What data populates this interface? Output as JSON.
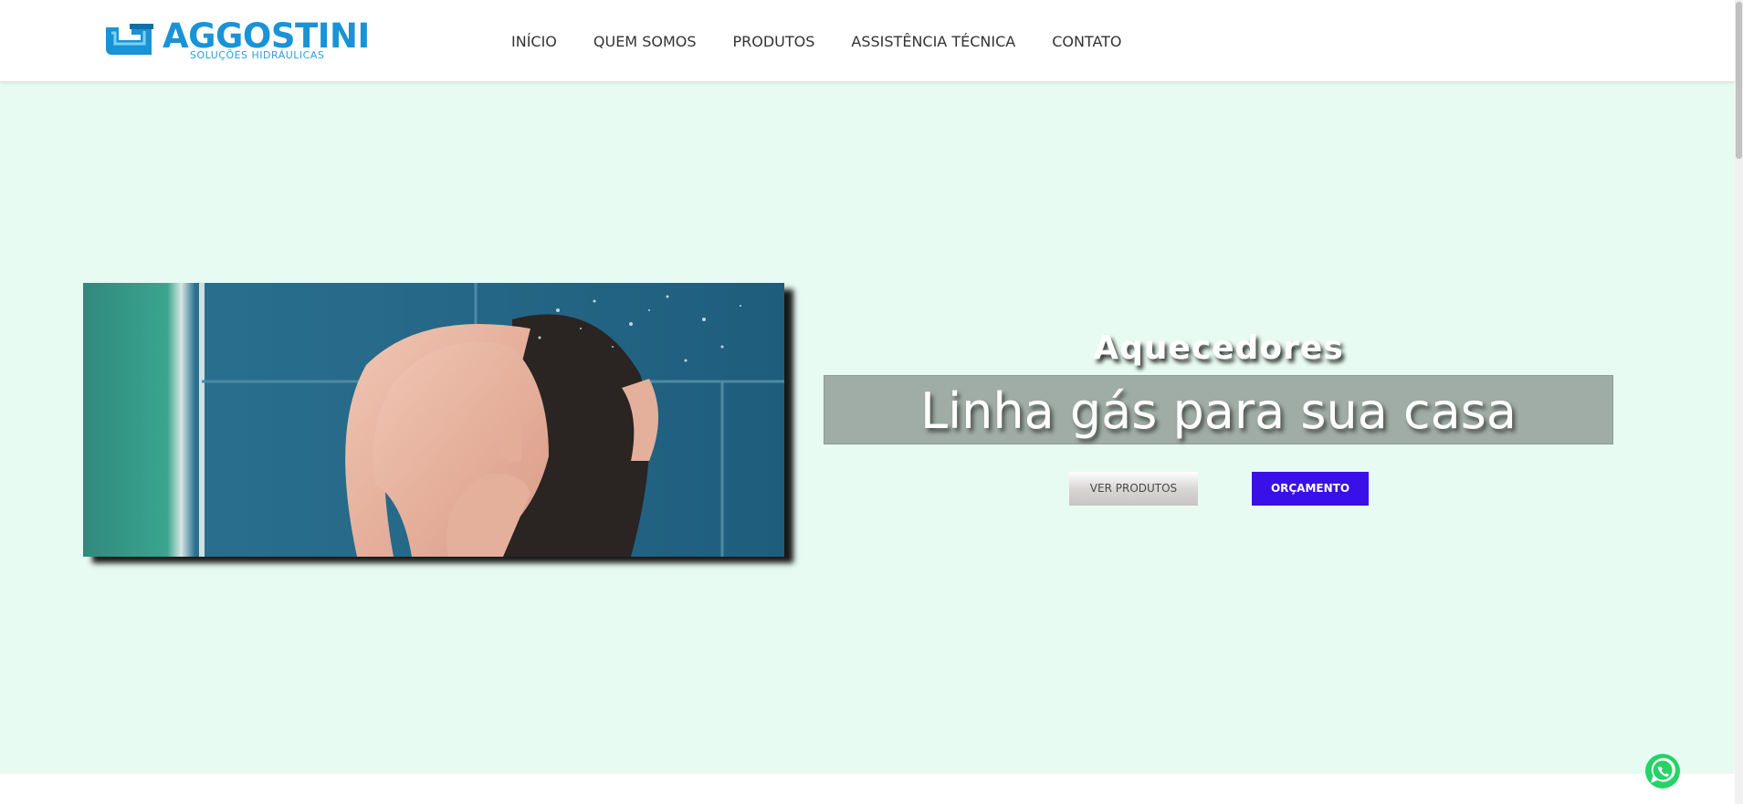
{
  "header": {
    "logo": {
      "title": "AGGOSTINI",
      "subtitle": "SOLUÇÕES HIDRÁULICAS"
    },
    "nav": [
      {
        "label": "INÍCIO"
      },
      {
        "label": "QUEM SOMOS"
      },
      {
        "label": "PRODUTOS"
      },
      {
        "label": "ASSISTÊNCIA TÉCNICA"
      },
      {
        "label": "CONTATO"
      }
    ]
  },
  "hero": {
    "kicker": "Aquecedores",
    "title": "Linha gás para sua casa",
    "buttons": {
      "secondary": "VER PRODUTOS",
      "primary": "ORÇAMENTO"
    },
    "image": {
      "icon": "shower-photo"
    }
  },
  "colors": {
    "brand_blue": "#1a93d6",
    "hero_bg": "#e8fbf2",
    "primary_button": "#3a10e8",
    "title_band": "#a0aca6",
    "whatsapp_green": "#25d366"
  },
  "icons": {
    "whatsapp": "whatsapp-icon",
    "logo_mark": "pipe-logo-icon"
  }
}
